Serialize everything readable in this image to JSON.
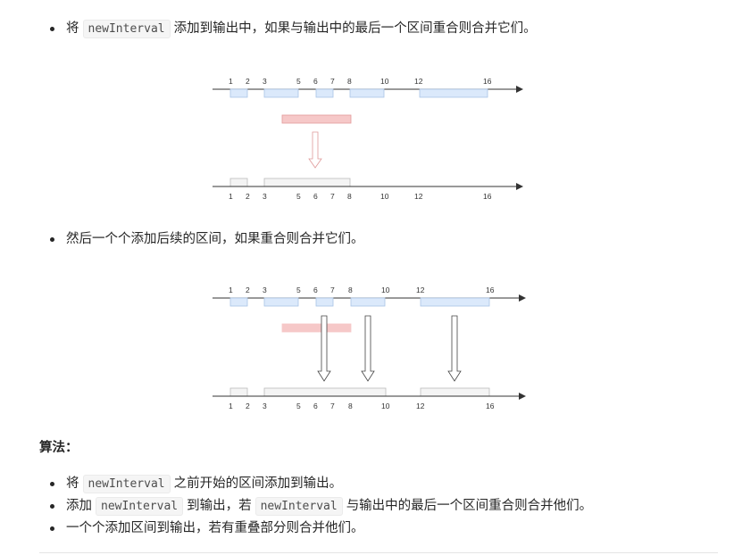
{
  "step1": {
    "prefix": "将",
    "code": "newInterval",
    "suffix": "添加到输出中，如果与输出中的最后一个区间重合则合并它们。"
  },
  "step2": {
    "text": "然后一个个添加后续的区间，如果重合则合并它们。"
  },
  "algorithm_heading": "算法：",
  "algorithm_steps": [
    {
      "prefix": "将",
      "code": "newInterval",
      "suffix": "之前开始的区间添加到输出。"
    },
    {
      "prefix": "添加",
      "code": "newInterval",
      "mid": "到输出，若",
      "code2": "newInterval",
      "suffix": "与输出中的最后一个区间重合则合并他们。"
    },
    {
      "text": "一个个添加区间到输出，若有重叠部分则合并他们。"
    }
  ],
  "diagram1": {
    "top_ticks": [
      "1",
      "2",
      "3",
      "5",
      "6",
      "7",
      "8",
      "10",
      "12",
      "16"
    ],
    "bottom_ticks": [
      "1",
      "2",
      "3",
      "5",
      "6",
      "7",
      "8",
      "10",
      "12",
      "16"
    ]
  },
  "diagram2": {
    "top_ticks": [
      "1",
      "2",
      "3",
      "5",
      "6",
      "7",
      "8",
      "10",
      "12",
      "16"
    ],
    "bottom_ticks": [
      "1",
      "2",
      "3",
      "5",
      "6",
      "7",
      "8",
      "10",
      "12",
      "16"
    ]
  },
  "colors": {
    "interval_blue": "#dbe9fb",
    "new_interval_red": "#f6c8c8",
    "merged_gray": "#f4f4f4"
  }
}
